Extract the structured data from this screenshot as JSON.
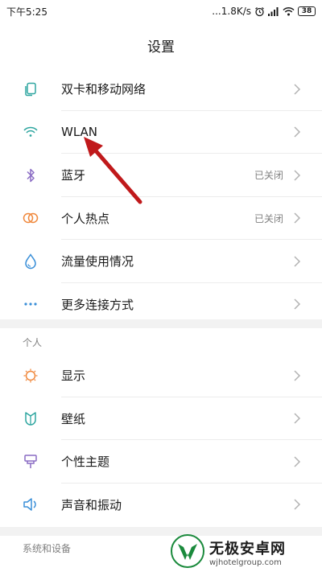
{
  "status_bar": {
    "time": "下午5:25",
    "network_speed": "...1.8K/s",
    "battery": "38"
  },
  "header": {
    "title": "设置"
  },
  "groups": [
    {
      "items": [
        {
          "label": "双卡和移动网络",
          "icon": "sim-cards-icon"
        },
        {
          "label": "WLAN",
          "icon": "wifi-icon"
        },
        {
          "label": "蓝牙",
          "value": "已关闭",
          "icon": "bluetooth-icon"
        },
        {
          "label": "个人热点",
          "value": "已关闭",
          "icon": "hotspot-icon"
        },
        {
          "label": "流量使用情况",
          "icon": "data-usage-icon"
        },
        {
          "label": "更多连接方式",
          "icon": "more-connections-icon"
        }
      ]
    },
    {
      "header": "个人",
      "items": [
        {
          "label": "显示",
          "icon": "display-icon"
        },
        {
          "label": "壁纸",
          "icon": "wallpaper-icon"
        },
        {
          "label": "个性主题",
          "icon": "theme-icon"
        },
        {
          "label": "声音和振动",
          "icon": "sound-icon"
        }
      ]
    },
    {
      "header": "系统和设备"
    }
  ],
  "watermark": {
    "name": "无极安卓网",
    "url": "wjhotelgroup.com"
  },
  "colors": {
    "icon_teal": "#2fa6a0",
    "icon_orange": "#f0883c",
    "icon_purple": "#8a6cc4",
    "icon_blue": "#3a8fd8",
    "arrow_red": "#c0191b",
    "logo_green": "#1a8a3c"
  }
}
